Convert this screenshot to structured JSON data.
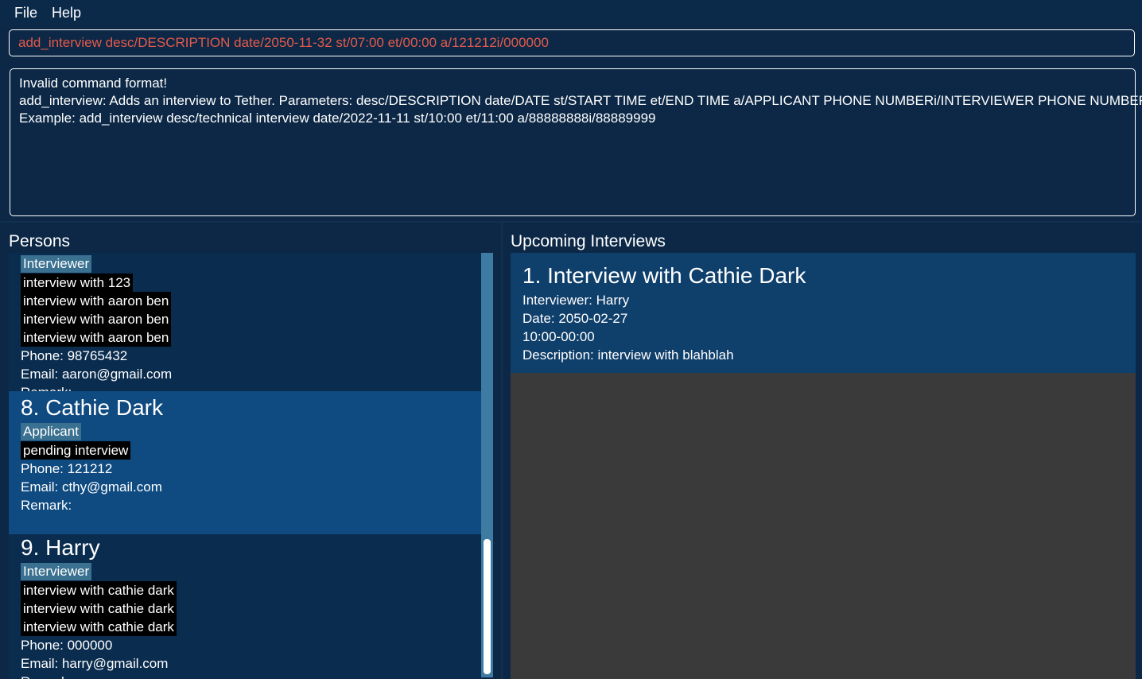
{
  "menu": {
    "file_label": "File",
    "help_label": "Help"
  },
  "command_box": {
    "value": "add_interview desc/DESCRIPTION date/2050-11-32 st/07:00 et/00:00 a/121212i/000000"
  },
  "result_display": {
    "lines": [
      "Invalid command format!",
      "add_interview: Adds an interview to Tether. Parameters: desc/DESCRIPTION date/DATE st/START TIME et/END TIME a/APPLICANT PHONE NUMBERi/INTERVIEWER PHONE NUMBER",
      "Example: add_interview desc/technical interview date/2022-11-11 st/10:00 et/11:00 a/88888888i/88889999"
    ]
  },
  "persons_panel": {
    "title": "Persons",
    "partial_card": {
      "role": "Interviewer",
      "interviews": [
        "interview with 123",
        "interview with aaron ben",
        "interview with aaron ben",
        "interview with aaron ben"
      ],
      "phone": "Phone: 98765432",
      "email": "Email: aaron@gmail.com",
      "remark": "Remark:"
    },
    "cards": [
      {
        "index": "8.",
        "name": "Cathie Dark",
        "role": "Applicant",
        "interviews": [
          "pending interview"
        ],
        "phone": "Phone: 121212",
        "email": "Email: cthy@gmail.com",
        "remark": "Remark:",
        "selected": true
      },
      {
        "index": "9.",
        "name": "Harry",
        "role": "Interviewer",
        "interviews": [
          "interview with cathie dark",
          "interview with cathie dark",
          "interview with cathie dark"
        ],
        "phone": "Phone: 000000",
        "email": "Email: harry@gmail.com",
        "remark": "Remark:",
        "selected": false
      }
    ]
  },
  "interviews_panel": {
    "title": "Upcoming Interviews",
    "items": [
      {
        "index": "1.",
        "title": "Interview with Cathie Dark",
        "interviewer": "Interviewer: Harry",
        "date": "Date: 2050-02-27",
        "time": "10:00-00:00",
        "description": "Description: interview with blahblah"
      }
    ]
  },
  "colors": {
    "background": "#0c2846",
    "selected_card": "#0f4a80",
    "role_tag": "#3a7090",
    "interview_tag": "#000000",
    "error_text": "#e55a4a",
    "empty_area": "#3a3a3a",
    "scrollbar": "#3d7ba3"
  }
}
